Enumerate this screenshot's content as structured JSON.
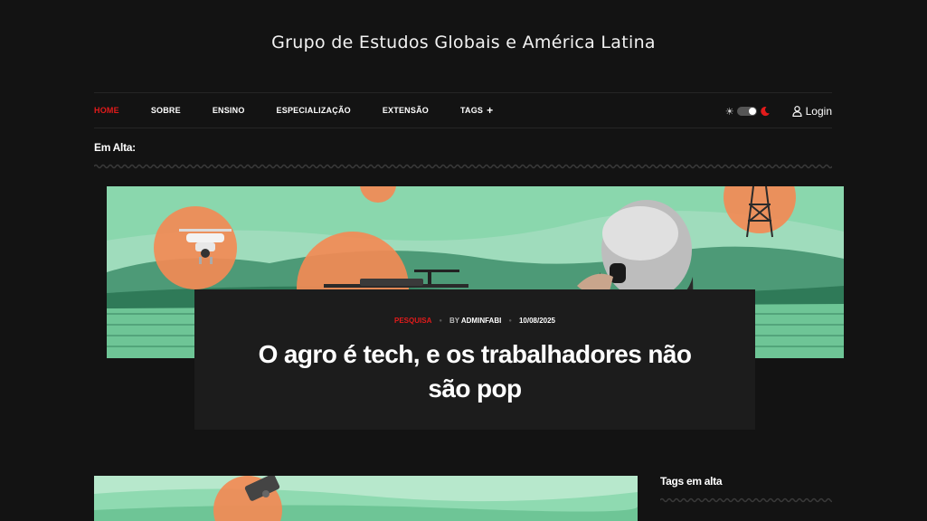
{
  "site": {
    "title": "Grupo de Estudos Globais e América Latina"
  },
  "nav": {
    "items": [
      {
        "label": "HOME",
        "active": true
      },
      {
        "label": "SOBRE"
      },
      {
        "label": "ENSINO"
      },
      {
        "label": "ESPECIALIZAÇÃO"
      },
      {
        "label": "EXTENSÃO"
      }
    ],
    "tags_label": "TAGS",
    "tags_plus": "+",
    "login_label": "Login"
  },
  "trending": {
    "label": "Em Alta:"
  },
  "hero": {
    "category": "PESQUISA",
    "by": "BY",
    "author": "ADMINFABI",
    "date": "10/08/2025",
    "title": "O agro é tech, e os trabalhadores não são pop"
  },
  "sidebar": {
    "tags_title": "Tags em alta"
  },
  "colors": {
    "background": "#131313",
    "accent": "#e21b1b",
    "card": "#1c1c1c",
    "illustration_green": "#7fd9a8",
    "illustration_orange": "#f28a55"
  },
  "icons": [
    "sun-icon",
    "theme-toggle",
    "moon-icon",
    "user-icon",
    "plus-icon"
  ]
}
